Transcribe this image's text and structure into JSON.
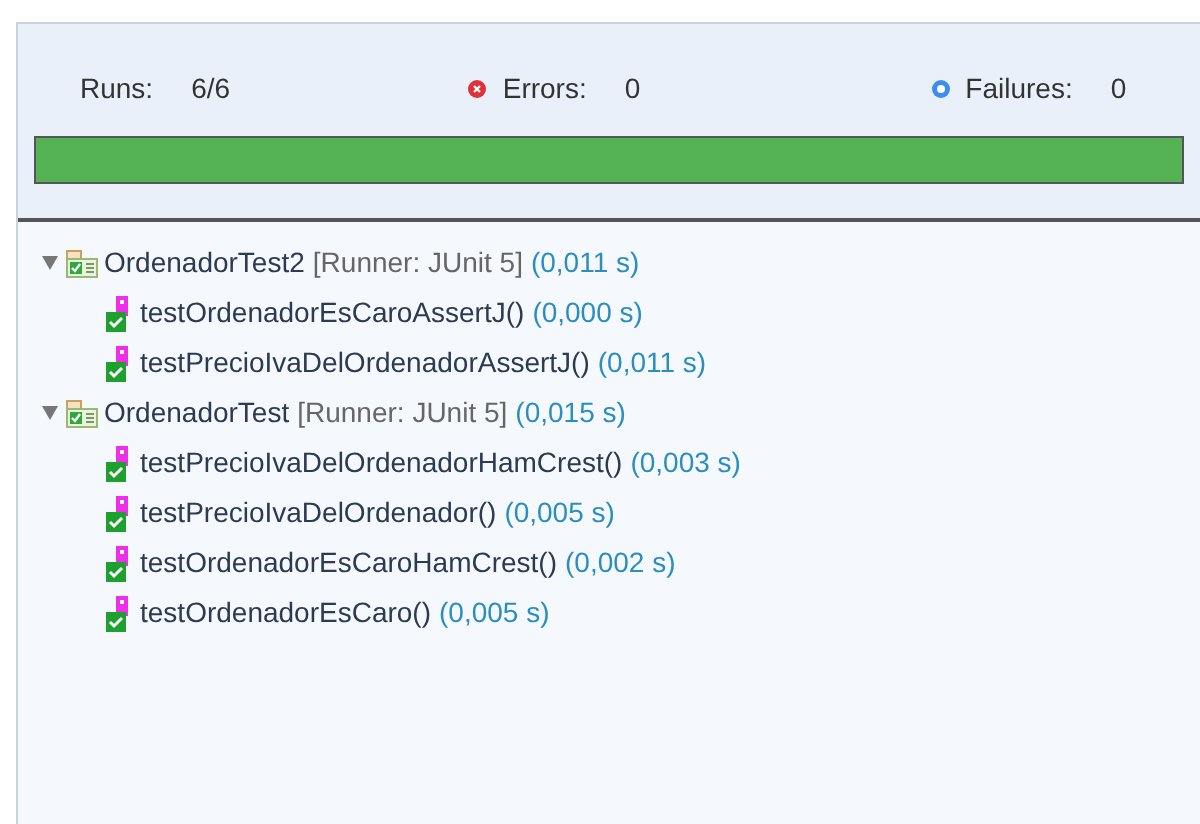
{
  "counters": [
    {
      "kind": "runs",
      "label": "Runs:",
      "value": "6/6"
    },
    {
      "kind": "errors",
      "label": "Errors:",
      "value": "0"
    },
    {
      "kind": "failures",
      "label": "Failures:",
      "value": "0"
    }
  ],
  "progress": {
    "level": 1,
    "passed": true
  },
  "tree": [
    {
      "name": "OrdenadorTest2",
      "runner": "[Runner: JUnit 5]",
      "time": "(0,011 s)",
      "expanded": true,
      "children": [
        {
          "name": "testOrdenadorEsCaroAssertJ()",
          "time": "(0,000 s)"
        },
        {
          "name": "testPrecioIvaDelOrdenadorAssertJ()",
          "time": "(0,011 s)"
        }
      ]
    },
    {
      "name": "OrdenadorTest",
      "runner": "[Runner: JUnit 5]",
      "time": "(0,015 s)",
      "expanded": true,
      "children": [
        {
          "name": "testPrecioIvaDelOrdenadorHamCrest()",
          "time": "(0,003 s)"
        },
        {
          "name": "testPrecioIvaDelOrdenador()",
          "time": "(0,005 s)"
        },
        {
          "name": "testOrdenadorEsCaroHamCrest()",
          "time": "(0,002 s)"
        },
        {
          "name": "testOrdenadorEsCaro()",
          "time": "(0,005 s)"
        }
      ]
    }
  ]
}
